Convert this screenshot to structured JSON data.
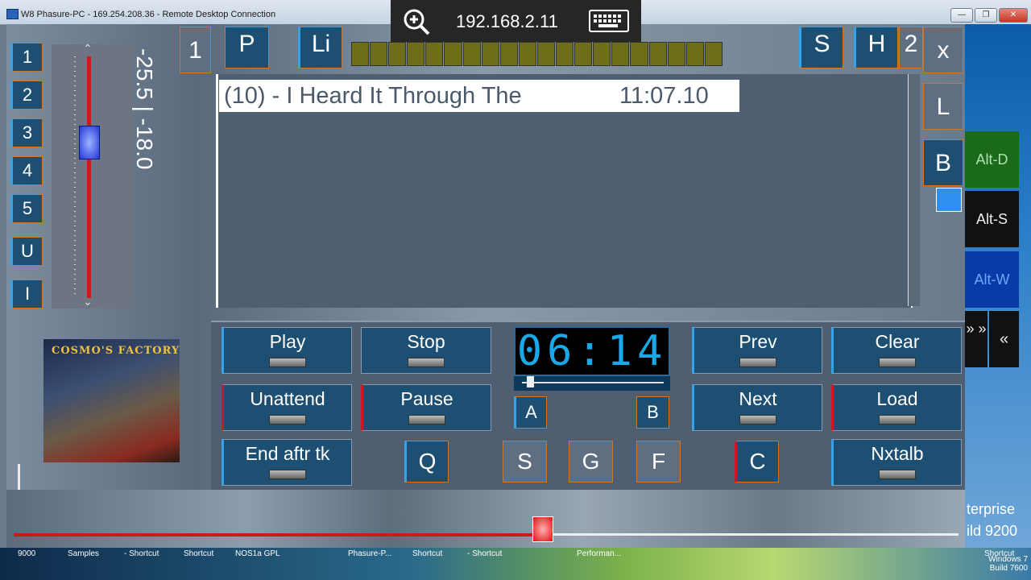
{
  "window": {
    "title": "W8 Phasure-PC - 169.254.208.36 - Remote Desktop Connection",
    "minimize": "—",
    "restore": "❐",
    "close": "✕"
  },
  "rdp": {
    "ip": "192.168.2.11"
  },
  "left_buttons": [
    "1",
    "2",
    "3",
    "4",
    "5",
    "U",
    "I"
  ],
  "volume": {
    "readout": "-25.5 | -18.0",
    "level": 0.33
  },
  "album": {
    "title": "COSMO'S FACTORY"
  },
  "top_buttons": {
    "one": "1",
    "p": "P",
    "li": "Li",
    "s": "S",
    "h": "H",
    "two": "2",
    "x": "x",
    "l": "L",
    "b": "B"
  },
  "meter_cells": 20,
  "playlist": {
    "track": "(10) - I Heard It Through The",
    "time": "11:07.10"
  },
  "controls": {
    "play": "Play",
    "stop": "Stop",
    "prev": "Prev",
    "clear": "Clear",
    "unattend": "Unattend",
    "pause": "Pause",
    "next": "Next",
    "load": "Load",
    "end_after": "End aftr tk",
    "nxtalb": "Nxtalb",
    "a": "A",
    "b": "B",
    "q": "Q",
    "s": "S",
    "g": "G",
    "f": "F",
    "c": "C"
  },
  "clock": {
    "value": "06:14",
    "progress": 0.05
  },
  "side": {
    "alt_d": "Alt-D",
    "alt_s": "Alt-S",
    "alt_w": "Alt-W",
    "scroll_left": "» »",
    "scroll_right": "«"
  },
  "desktop": {
    "enterprise": "terprise",
    "build": "ild 9200",
    "win7_line1": "Windows 7",
    "win7_line2": "Build 7600"
  },
  "seek": {
    "position": 0.56
  },
  "taskbar_items": [
    "9000",
    "Samples",
    "- Shortcut",
    "Shortcut",
    "NOS1a GPL",
    "Phasure-P...",
    "Shortcut",
    "- Shortcut",
    "Performan...",
    "Shortcut"
  ],
  "colors": {
    "button_bg": "#1c4f72",
    "accent_blue": "#36a3e8",
    "accent_red": "#c81c1c",
    "clock_digits": "#1ba8e8"
  }
}
